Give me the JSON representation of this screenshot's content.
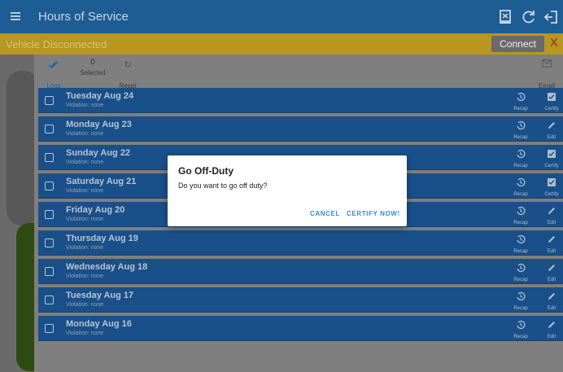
{
  "app_bar": {
    "title": "Hours of Service",
    "background": "#1e5d93"
  },
  "banner": {
    "message": "Vehicle Disconnected",
    "connect_label": "Connect",
    "close_label": "X",
    "background": "#b8961f"
  },
  "toolbar": {
    "logs_label": "Logs",
    "selected_count": "0",
    "selected_label": "Selected",
    "reset_label": "Reset",
    "email_label": "Email"
  },
  "logs": [
    {
      "day": "Tuesday Aug 24",
      "violation": "Violation: none",
      "recap_label": "Recap",
      "action_label": "Certify",
      "action_icon": "certify-check-icon"
    },
    {
      "day": "Monday Aug 23",
      "violation": "Violation: none",
      "recap_label": "Recap",
      "action_label": "Edit",
      "action_icon": "edit-pencil-icon"
    },
    {
      "day": "Sunday Aug 22",
      "violation": "Violation: none",
      "recap_label": "Recap",
      "action_label": "Certify",
      "action_icon": "certify-check-icon"
    },
    {
      "day": "Saturday Aug 21",
      "violation": "Violation: none",
      "recap_label": "Recap",
      "action_label": "Certify",
      "action_icon": "certify-check-icon"
    },
    {
      "day": "Friday Aug 20",
      "violation": "Violation: none",
      "recap_label": "Recap",
      "action_label": "Edit",
      "action_icon": "edit-pencil-icon"
    },
    {
      "day": "Thursday Aug 19",
      "violation": "Violation: none",
      "recap_label": "Recap",
      "action_label": "Edit",
      "action_icon": "edit-pencil-icon"
    },
    {
      "day": "Wednesday Aug 18",
      "violation": "Violation: none",
      "recap_label": "Recap",
      "action_label": "Edit",
      "action_icon": "edit-pencil-icon"
    },
    {
      "day": "Tuesday Aug 17",
      "violation": "Violation: none",
      "recap_label": "Recap",
      "action_label": "Edit",
      "action_icon": "edit-pencil-icon"
    },
    {
      "day": "Monday Aug 16",
      "violation": "Violation: none",
      "recap_label": "Recap",
      "action_label": "Edit",
      "action_icon": "edit-pencil-icon"
    }
  ],
  "dialog": {
    "title": "Go Off-Duty",
    "message": "Do you want to go off duty?",
    "cancel_label": "CANCEL",
    "confirm_label": "CERTIFY NOW!",
    "accent": "#2e8fd6"
  }
}
